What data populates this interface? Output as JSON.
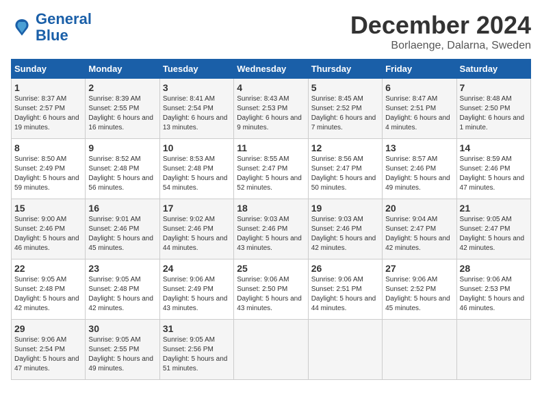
{
  "header": {
    "logo_line1": "General",
    "logo_line2": "Blue",
    "month": "December 2024",
    "location": "Borlaenge, Dalarna, Sweden"
  },
  "weekdays": [
    "Sunday",
    "Monday",
    "Tuesday",
    "Wednesday",
    "Thursday",
    "Friday",
    "Saturday"
  ],
  "weeks": [
    [
      {
        "day": "1",
        "sunrise": "Sunrise: 8:37 AM",
        "sunset": "Sunset: 2:57 PM",
        "daylight": "Daylight: 6 hours and 19 minutes."
      },
      {
        "day": "2",
        "sunrise": "Sunrise: 8:39 AM",
        "sunset": "Sunset: 2:55 PM",
        "daylight": "Daylight: 6 hours and 16 minutes."
      },
      {
        "day": "3",
        "sunrise": "Sunrise: 8:41 AM",
        "sunset": "Sunset: 2:54 PM",
        "daylight": "Daylight: 6 hours and 13 minutes."
      },
      {
        "day": "4",
        "sunrise": "Sunrise: 8:43 AM",
        "sunset": "Sunset: 2:53 PM",
        "daylight": "Daylight: 6 hours and 9 minutes."
      },
      {
        "day": "5",
        "sunrise": "Sunrise: 8:45 AM",
        "sunset": "Sunset: 2:52 PM",
        "daylight": "Daylight: 6 hours and 7 minutes."
      },
      {
        "day": "6",
        "sunrise": "Sunrise: 8:47 AM",
        "sunset": "Sunset: 2:51 PM",
        "daylight": "Daylight: 6 hours and 4 minutes."
      },
      {
        "day": "7",
        "sunrise": "Sunrise: 8:48 AM",
        "sunset": "Sunset: 2:50 PM",
        "daylight": "Daylight: 6 hours and 1 minute."
      }
    ],
    [
      {
        "day": "8",
        "sunrise": "Sunrise: 8:50 AM",
        "sunset": "Sunset: 2:49 PM",
        "daylight": "Daylight: 5 hours and 59 minutes."
      },
      {
        "day": "9",
        "sunrise": "Sunrise: 8:52 AM",
        "sunset": "Sunset: 2:48 PM",
        "daylight": "Daylight: 5 hours and 56 minutes."
      },
      {
        "day": "10",
        "sunrise": "Sunrise: 8:53 AM",
        "sunset": "Sunset: 2:48 PM",
        "daylight": "Daylight: 5 hours and 54 minutes."
      },
      {
        "day": "11",
        "sunrise": "Sunrise: 8:55 AM",
        "sunset": "Sunset: 2:47 PM",
        "daylight": "Daylight: 5 hours and 52 minutes."
      },
      {
        "day": "12",
        "sunrise": "Sunrise: 8:56 AM",
        "sunset": "Sunset: 2:47 PM",
        "daylight": "Daylight: 5 hours and 50 minutes."
      },
      {
        "day": "13",
        "sunrise": "Sunrise: 8:57 AM",
        "sunset": "Sunset: 2:46 PM",
        "daylight": "Daylight: 5 hours and 49 minutes."
      },
      {
        "day": "14",
        "sunrise": "Sunrise: 8:59 AM",
        "sunset": "Sunset: 2:46 PM",
        "daylight": "Daylight: 5 hours and 47 minutes."
      }
    ],
    [
      {
        "day": "15",
        "sunrise": "Sunrise: 9:00 AM",
        "sunset": "Sunset: 2:46 PM",
        "daylight": "Daylight: 5 hours and 46 minutes."
      },
      {
        "day": "16",
        "sunrise": "Sunrise: 9:01 AM",
        "sunset": "Sunset: 2:46 PM",
        "daylight": "Daylight: 5 hours and 45 minutes."
      },
      {
        "day": "17",
        "sunrise": "Sunrise: 9:02 AM",
        "sunset": "Sunset: 2:46 PM",
        "daylight": "Daylight: 5 hours and 44 minutes."
      },
      {
        "day": "18",
        "sunrise": "Sunrise: 9:03 AM",
        "sunset": "Sunset: 2:46 PM",
        "daylight": "Daylight: 5 hours and 43 minutes."
      },
      {
        "day": "19",
        "sunrise": "Sunrise: 9:03 AM",
        "sunset": "Sunset: 2:46 PM",
        "daylight": "Daylight: 5 hours and 42 minutes."
      },
      {
        "day": "20",
        "sunrise": "Sunrise: 9:04 AM",
        "sunset": "Sunset: 2:47 PM",
        "daylight": "Daylight: 5 hours and 42 minutes."
      },
      {
        "day": "21",
        "sunrise": "Sunrise: 9:05 AM",
        "sunset": "Sunset: 2:47 PM",
        "daylight": "Daylight: 5 hours and 42 minutes."
      }
    ],
    [
      {
        "day": "22",
        "sunrise": "Sunrise: 9:05 AM",
        "sunset": "Sunset: 2:48 PM",
        "daylight": "Daylight: 5 hours and 42 minutes."
      },
      {
        "day": "23",
        "sunrise": "Sunrise: 9:05 AM",
        "sunset": "Sunset: 2:48 PM",
        "daylight": "Daylight: 5 hours and 42 minutes."
      },
      {
        "day": "24",
        "sunrise": "Sunrise: 9:06 AM",
        "sunset": "Sunset: 2:49 PM",
        "daylight": "Daylight: 5 hours and 43 minutes."
      },
      {
        "day": "25",
        "sunrise": "Sunrise: 9:06 AM",
        "sunset": "Sunset: 2:50 PM",
        "daylight": "Daylight: 5 hours and 43 minutes."
      },
      {
        "day": "26",
        "sunrise": "Sunrise: 9:06 AM",
        "sunset": "Sunset: 2:51 PM",
        "daylight": "Daylight: 5 hours and 44 minutes."
      },
      {
        "day": "27",
        "sunrise": "Sunrise: 9:06 AM",
        "sunset": "Sunset: 2:52 PM",
        "daylight": "Daylight: 5 hours and 45 minutes."
      },
      {
        "day": "28",
        "sunrise": "Sunrise: 9:06 AM",
        "sunset": "Sunset: 2:53 PM",
        "daylight": "Daylight: 5 hours and 46 minutes."
      }
    ],
    [
      {
        "day": "29",
        "sunrise": "Sunrise: 9:06 AM",
        "sunset": "Sunset: 2:54 PM",
        "daylight": "Daylight: 5 hours and 47 minutes."
      },
      {
        "day": "30",
        "sunrise": "Sunrise: 9:05 AM",
        "sunset": "Sunset: 2:55 PM",
        "daylight": "Daylight: 5 hours and 49 minutes."
      },
      {
        "day": "31",
        "sunrise": "Sunrise: 9:05 AM",
        "sunset": "Sunset: 2:56 PM",
        "daylight": "Daylight: 5 hours and 51 minutes."
      },
      null,
      null,
      null,
      null
    ]
  ]
}
